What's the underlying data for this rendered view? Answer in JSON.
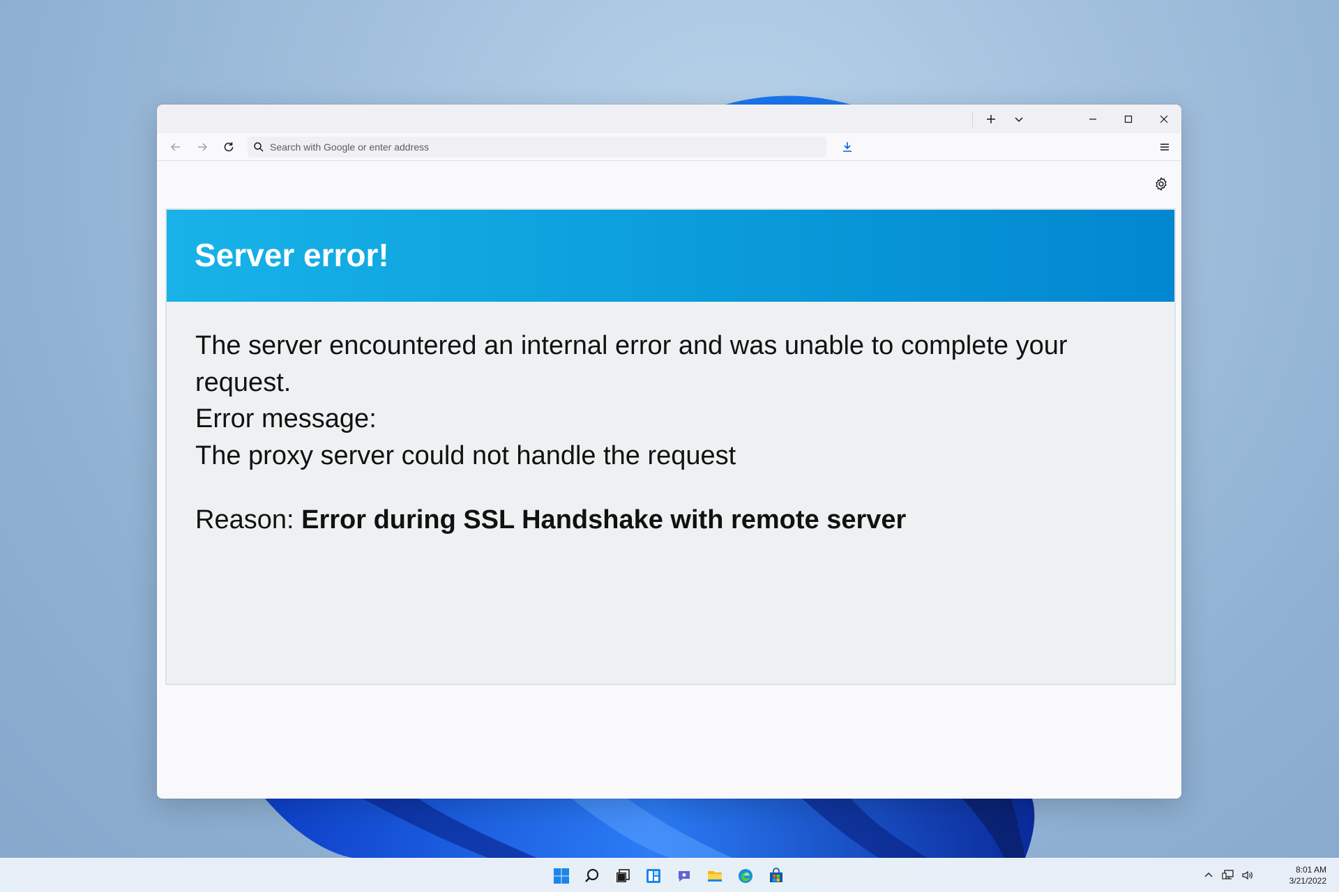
{
  "browser": {
    "address_bar": {
      "placeholder": "Search with Google or enter address"
    }
  },
  "error_page": {
    "title": "Server error!",
    "line1": "The server encountered an internal error and was unable to complete your request.",
    "line2": "Error message:",
    "line3": "The proxy server could not handle the request",
    "reason_label": "Reason:",
    "reason_value": "Error during SSL Handshake with remote server"
  },
  "taskbar": {
    "pinned": [
      "start-icon",
      "search-icon",
      "task-view-icon",
      "widgets-icon",
      "chat-icon",
      "file-explorer-icon",
      "edge-icon",
      "store-icon"
    ],
    "clock": {
      "time": "8:01 AM",
      "date": "3/21/2022"
    }
  },
  "colors": {
    "header_gradient_start": "#18b2e8",
    "header_gradient_end": "#0287d0",
    "accent": "#0078d4"
  }
}
